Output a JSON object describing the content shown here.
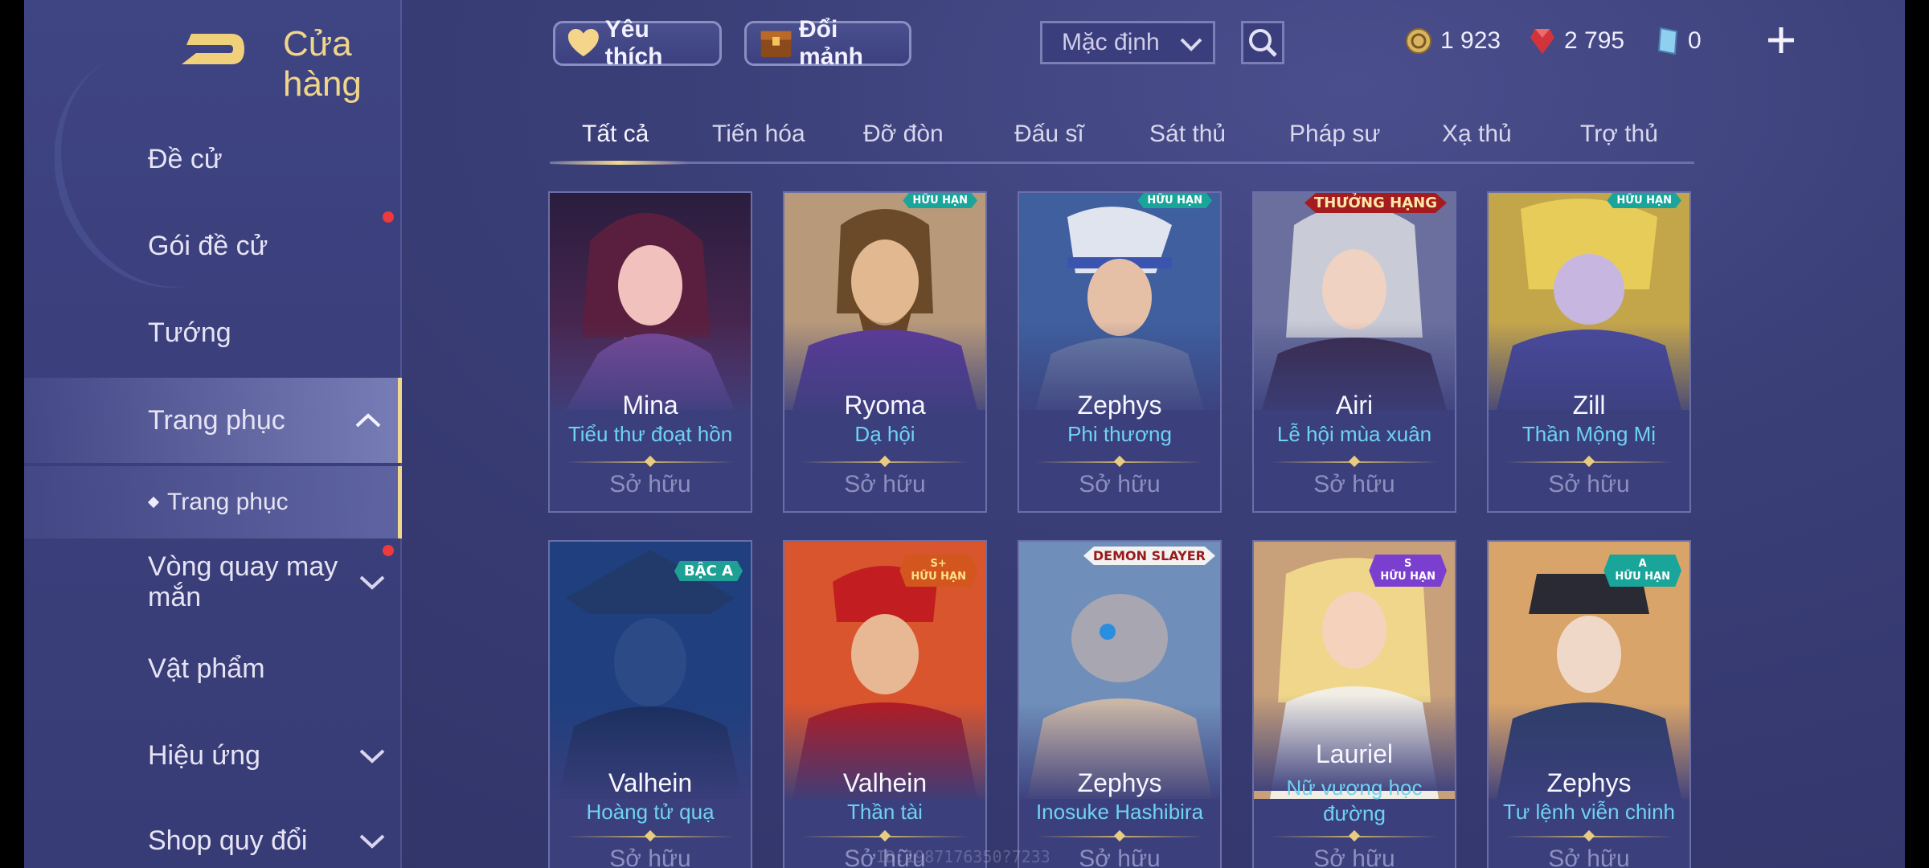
{
  "header": {
    "title": "Cửa hàng",
    "favorite_label": "Yêu thích",
    "exchange_label": "Đổi mảnh",
    "sort_value": "Mặc định",
    "currencies": [
      {
        "icon": "gold-coin-icon",
        "value": "1 923"
      },
      {
        "icon": "ruby-gem-icon",
        "value": "2 795"
      },
      {
        "icon": "voucher-icon",
        "value": "0"
      }
    ]
  },
  "sidebar": {
    "items": [
      {
        "label": "Đề cử"
      },
      {
        "label": "Gói đề cử"
      },
      {
        "label": "Tướng"
      },
      {
        "label": "Trang phục"
      },
      {
        "label": "Trang phục"
      },
      {
        "label": "Vòng quay may mắn"
      },
      {
        "label": "Vật phẩm"
      },
      {
        "label": "Hiệu ứng"
      },
      {
        "label": "Shop quy đổi"
      }
    ]
  },
  "tabs": [
    "Tất cả",
    "Tiến hóa",
    "Đỡ đòn",
    "Đấu sĩ",
    "Sát thủ",
    "Pháp sư",
    "Xạ thủ",
    "Trợ thủ"
  ],
  "cards": [
    {
      "hero": "Mina",
      "skin": "Tiểu thư đoạt hồn",
      "status": "Sở hữu",
      "badge": ""
    },
    {
      "hero": "Ryoma",
      "skin": "Dạ hội",
      "status": "Sở hữu",
      "badge": "HỮU HẠN"
    },
    {
      "hero": "Zephys",
      "skin": "Phi thương",
      "status": "Sở hữu",
      "badge": "HỮU HẠN"
    },
    {
      "hero": "Airi",
      "skin": "Lễ hội mùa xuân",
      "status": "Sở hữu",
      "badge": "THƯỞNG HẠNG"
    },
    {
      "hero": "Zill",
      "skin": "Thần Mộng Mị",
      "status": "Sở hữu",
      "badge": "HỮU HẠN"
    },
    {
      "hero": "Valhein",
      "skin": "Hoàng tử quạ",
      "status": "Sở hữu",
      "badge": "BẬC A"
    },
    {
      "hero": "Valhein",
      "skin": "Thần tài",
      "status": "Sở hữu",
      "badge_grade": "S+",
      "badge": "HỮU HẠN"
    },
    {
      "hero": "Zephys",
      "skin": "Inosuke Hashibira",
      "status": "Sở hữu",
      "badge": "DEMON SLAYER"
    },
    {
      "hero": "Lauriel",
      "skin": "Nữ vương học đường",
      "status": "Sở hữu",
      "badge_grade": "S",
      "badge": "HỮU HẠN"
    },
    {
      "hero": "Zephys",
      "skin": "Tư lệnh viễn chinh",
      "status": "Sở hữu",
      "badge_grade": "A",
      "badge": "HỮU HẠN"
    }
  ],
  "watermark": "ID:1987176350?7233",
  "colors": {
    "accent_gold": "#f1d88e",
    "skin_text": "#6fd3f0",
    "notification_red": "#ee3a3a"
  }
}
